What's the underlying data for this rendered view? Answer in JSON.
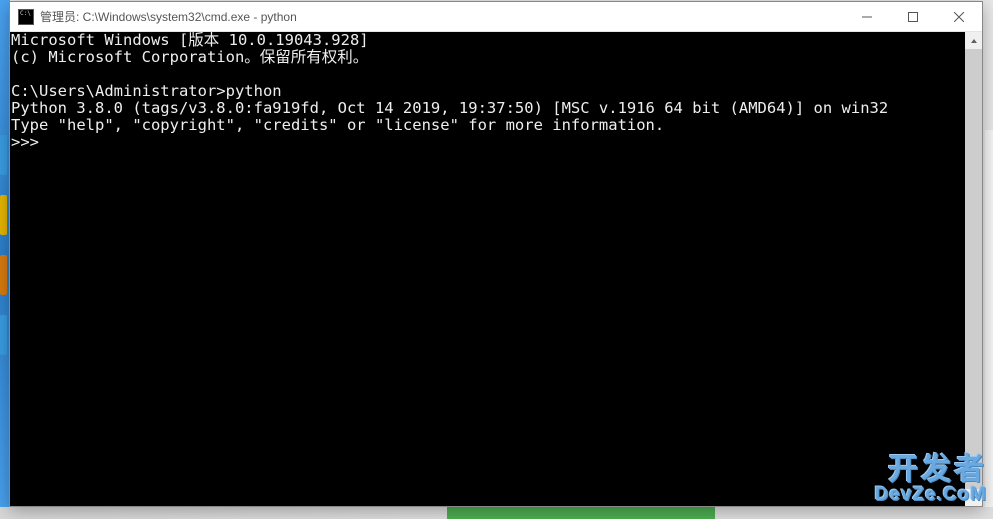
{
  "window": {
    "title": "管理员: C:\\Windows\\system32\\cmd.exe - python"
  },
  "terminal": {
    "line1": "Microsoft Windows [版本 10.0.19043.928]",
    "line2": "(c) Microsoft Corporation。保留所有权利。",
    "line3": "",
    "line4": "C:\\Users\\Administrator>python",
    "line5": "Python 3.8.0 (tags/v3.8.0:fa919fd, Oct 14 2019, 19:37:50) [MSC v.1916 64 bit (AMD64)] on win32",
    "line6": "Type \"help\", \"copyright\", \"credits\" or \"license\" for more information.",
    "line7": ">>> "
  },
  "watermark": {
    "cn": "开发者",
    "en": "DevZe.CoM"
  }
}
